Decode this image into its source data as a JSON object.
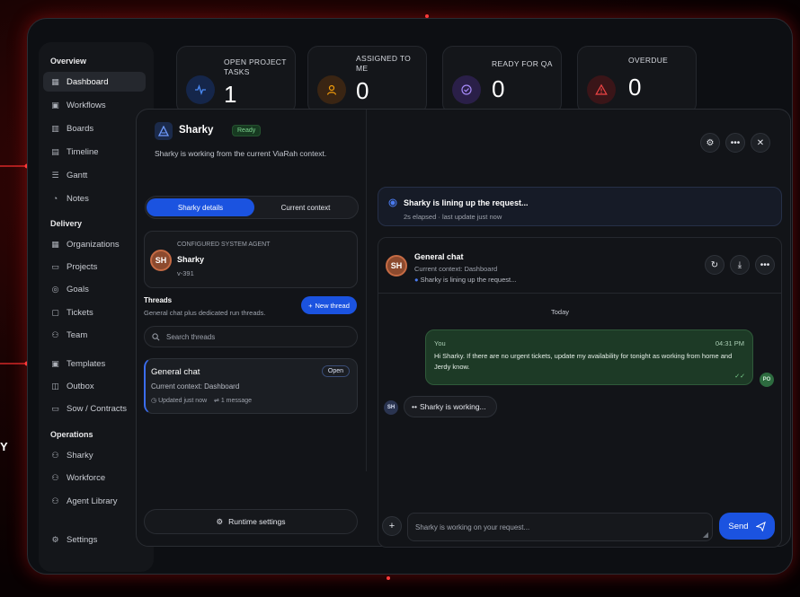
{
  "sidebar": {
    "sections": {
      "overview": "Overview",
      "delivery": "Delivery",
      "operations": "Operations"
    },
    "items": [
      {
        "label": "Dashboard",
        "icon": "grid-icon"
      },
      {
        "label": "Workflows",
        "icon": "briefcase-icon"
      },
      {
        "label": "Boards",
        "icon": "kanban-icon"
      },
      {
        "label": "Timeline",
        "icon": "calendar-icon"
      },
      {
        "label": "Gantt",
        "icon": "gantt-icon"
      },
      {
        "label": "Notes",
        "icon": "bell-icon"
      },
      {
        "label": "Organizations",
        "icon": "building-icon"
      },
      {
        "label": "Projects",
        "icon": "folder-icon"
      },
      {
        "label": "Goals",
        "icon": "target-icon"
      },
      {
        "label": "Tickets",
        "icon": "ticket-icon"
      },
      {
        "label": "Team",
        "icon": "users-icon"
      },
      {
        "label": "Templates",
        "icon": "template-icon"
      },
      {
        "label": "Outbox",
        "icon": "outbox-icon"
      },
      {
        "label": "Sow / Contracts",
        "icon": "contract-icon"
      },
      {
        "label": "Sharky",
        "icon": "sharky-icon"
      },
      {
        "label": "Workforce",
        "icon": "workforce-icon"
      },
      {
        "label": "Agent Library",
        "icon": "library-icon"
      }
    ],
    "settings": "Settings"
  },
  "stats": [
    {
      "label": "OPEN PROJECT TASKS",
      "value": "1",
      "color": "#3b82f6"
    },
    {
      "label": "ASSIGNED TO ME",
      "value": "0",
      "color": "#f59e0b"
    },
    {
      "label": "READY FOR QA",
      "value": "0",
      "color": "#a78bfa"
    },
    {
      "label": "OVERDUE",
      "value": "0",
      "color": "#ef4444"
    }
  ],
  "panel": {
    "title": "Sharky",
    "badge": "Ready",
    "subtitle": "Sharky is working from the current ViaRah context.",
    "tabs": [
      "Sharky details",
      "Current context"
    ],
    "agent": {
      "avatar": "SH",
      "kind": "CONFIGURED SYSTEM AGENT",
      "name": "Sharky",
      "version": "v-391"
    },
    "threads": {
      "heading": "Threads",
      "description": "General chat plus dedicated run threads.",
      "new_button": "New thread",
      "search_placeholder": "Search threads"
    },
    "thread_card": {
      "title": "General chat",
      "status": "Open",
      "context": "Current context: Dashboard",
      "updated": "Updated just now",
      "messages": "1 message"
    },
    "runtime_button": "Runtime settings"
  },
  "status": {
    "title": "Sharky is lining up the request...",
    "detail": "2s elapsed · last update just now"
  },
  "chat": {
    "avatar": "SH",
    "title": "General chat",
    "context": "Current context: Dashboard",
    "state": "Sharky is lining up the request...",
    "day_divider": "Today",
    "message": {
      "author": "You",
      "time": "04:31 PM",
      "text": "Hi Sharky. If there are no urgent tickets, update my availability for tonight as working from home and Jerdy know.",
      "avatar": "PO"
    },
    "typing_avatar": "SH",
    "typing_text": "Sharky is working...",
    "composer_placeholder": "Sharky is working on your request...",
    "send_label": "Send"
  },
  "edge_text": "Y"
}
